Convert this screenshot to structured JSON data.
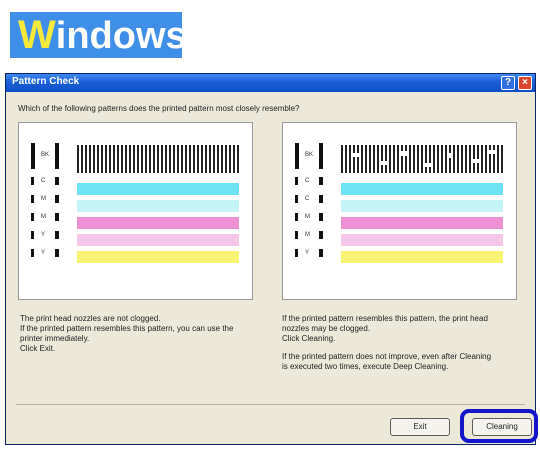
{
  "banner": {
    "first_letter": "W",
    "rest": "indows"
  },
  "dialog": {
    "title": "Pattern Check",
    "help_glyph": "?",
    "close_glyph": "×",
    "question": "Which of the following patterns does the printed pattern most closely resemble?",
    "left_pattern": {
      "labels": [
        "C",
        "M",
        "M",
        "Y",
        "Y"
      ],
      "top_label": "BK"
    },
    "right_pattern": {
      "labels": [
        "C",
        "C",
        "M",
        "M",
        "Y"
      ],
      "top_label": "BK"
    },
    "left_description": [
      "The print head nozzles are not clogged.",
      "If the printed pattern resembles this pattern, you can use the",
      "printer immediately.",
      "Click Exit."
    ],
    "right_description": [
      "If the printed pattern resembles this pattern, the print head",
      "nozzles may be clogged.",
      "Click Cleaning.",
      "",
      "If the printed pattern does not improve, even after Cleaning",
      "is executed two times, execute Deep Cleaning."
    ],
    "exit_label": "Exit",
    "cleaning_label": "Cleaning"
  },
  "colors": {
    "cyan": "#6fe3f3",
    "light_cyan": "#c4f4f8",
    "magenta": "#ef8fd6",
    "light_magenta": "#f8c6ea",
    "yellow": "#f8f275",
    "highlight": "#1216c8"
  }
}
